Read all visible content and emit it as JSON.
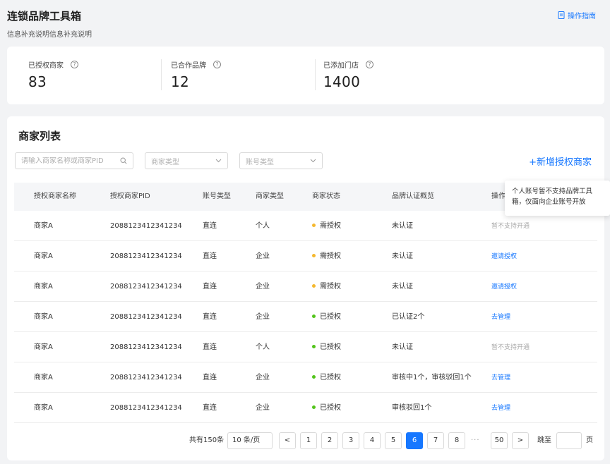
{
  "header": {
    "title": "连锁品牌工具箱",
    "subtitle": "信息补充说明信息补充说明",
    "guide_label": "操作指南"
  },
  "stats": [
    {
      "label": "已授权商家",
      "value": "83"
    },
    {
      "label": "已合作品牌",
      "value": "12"
    },
    {
      "label": "已添加门店",
      "value": "1400"
    }
  ],
  "list": {
    "title": "商家列表",
    "search_placeholder": "请输入商家名称或商家PID",
    "merchant_type_placeholder": "商家类型",
    "account_type_placeholder": "账号类型",
    "add_button": "+新增授权商家",
    "columns": [
      "授权商家名称",
      "授权商家PID",
      "账号类型",
      "商家类型",
      "商家状态",
      "品牌认证概览",
      "操作"
    ],
    "rows": [
      {
        "name": "商家A",
        "pid": "2088123412341234",
        "account": "直连",
        "type": "个人",
        "status": "需授权",
        "brand": "未认证",
        "action": "暂不支持开通",
        "action_enabled": false
      },
      {
        "name": "商家A",
        "pid": "2088123412341234",
        "account": "直连",
        "type": "企业",
        "status": "需授权",
        "brand": "未认证",
        "action": "邀请授权",
        "action_enabled": true
      },
      {
        "name": "商家A",
        "pid": "2088123412341234",
        "account": "直连",
        "type": "企业",
        "status": "需授权",
        "brand": "未认证",
        "action": "邀请授权",
        "action_enabled": true
      },
      {
        "name": "商家A",
        "pid": "2088123412341234",
        "account": "直连",
        "type": "企业",
        "status": "已授权",
        "brand": "已认证2个",
        "action": "去管理",
        "action_enabled": true
      },
      {
        "name": "商家A",
        "pid": "2088123412341234",
        "account": "直连",
        "type": "个人",
        "status": "已授权",
        "brand": "未认证",
        "action": "暂不支持开通",
        "action_enabled": false
      },
      {
        "name": "商家A",
        "pid": "2088123412341234",
        "account": "直连",
        "type": "企业",
        "status": "已授权",
        "brand": "审核中1个，审核驳回1个",
        "action": "去管理",
        "action_enabled": true
      },
      {
        "name": "商家A",
        "pid": "2088123412341234",
        "account": "直连",
        "type": "企业",
        "status": "已授权",
        "brand": "审核驳回1个",
        "action": "去管理",
        "action_enabled": true
      }
    ]
  },
  "status_colors": {
    "需授权": "#f5b82e",
    "已授权": "#52c41a"
  },
  "pagination": {
    "total_text": "共有150条",
    "page_size": "10 条/页",
    "prev": "<",
    "next": ">",
    "pages": [
      "1",
      "2",
      "3",
      "4",
      "5",
      "6",
      "7",
      "8"
    ],
    "ellipsis": "···",
    "last": "50",
    "current": "6",
    "jump_label": "跳至",
    "page_suffix": "页"
  },
  "tooltip": {
    "text": "个人账号暂不支持品牌工具箱，仅面向企业账号开放"
  }
}
